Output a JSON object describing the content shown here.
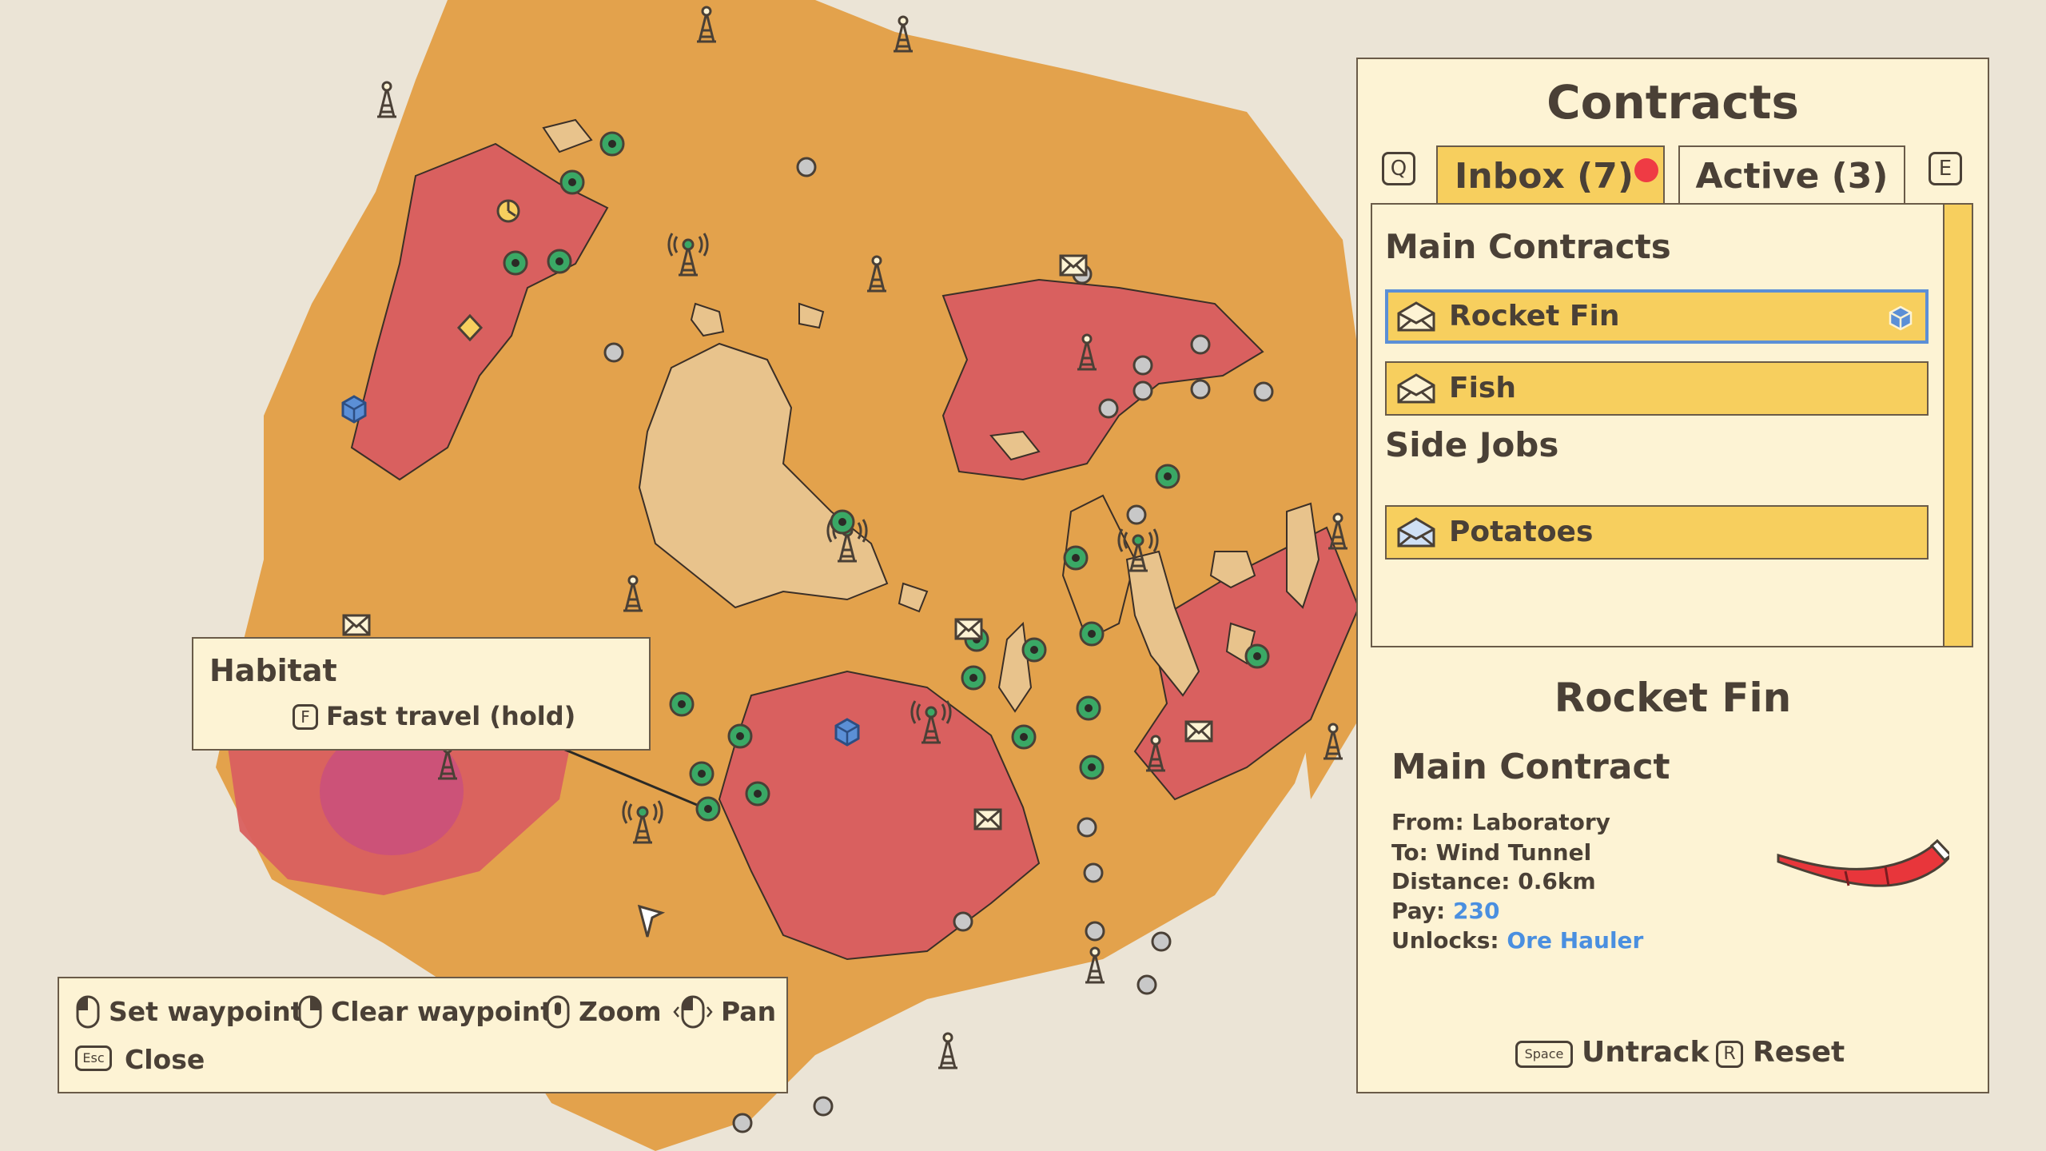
{
  "contracts": {
    "title": "Contracts",
    "prev_key": "Q",
    "next_key": "E",
    "tabs": [
      {
        "label": "Inbox (7)",
        "active": true,
        "has_notification": true
      },
      {
        "label": "Active (3)",
        "active": false
      }
    ],
    "sections": [
      {
        "heading": "Main Contracts",
        "items": [
          {
            "label": "Rocket Fin",
            "selected": true,
            "icon": "envelope-open-icon",
            "tracked_icon": "package-icon"
          },
          {
            "label": "Fish",
            "selected": false,
            "icon": "envelope-open-icon"
          }
        ]
      },
      {
        "heading": "Side Jobs",
        "items": [
          {
            "label": "Potatoes",
            "selected": false,
            "icon": "envelope-open-icon"
          }
        ]
      }
    ]
  },
  "detail": {
    "title": "Rocket Fin",
    "category": "Main Contract",
    "from_label": "From:",
    "from": "Laboratory",
    "to_label": "To:",
    "to": "Wind Tunnel",
    "distance_label": "Distance:",
    "distance": "0.6km",
    "pay_label": "Pay:",
    "pay": "230",
    "unlocks_label": "Unlocks:",
    "unlocks": "Ore Hauler",
    "untrack_key": "Space",
    "untrack_label": "Untrack",
    "reset_key": "R",
    "reset_label": "Reset"
  },
  "tooltip": {
    "title": "Habitat",
    "key": "F",
    "action": "Fast travel (hold)"
  },
  "controls": [
    {
      "icon": "mouse-left-icon",
      "label": "Set waypoint"
    },
    {
      "icon": "mouse-right-icon",
      "label": "Clear waypoint"
    },
    {
      "icon": "mouse-scroll-icon",
      "label": "Zoom"
    },
    {
      "icon": "mouse-drag-icon",
      "label": "Pan"
    },
    {
      "icon": "esc-key-icon",
      "key": "Esc",
      "label": "Close"
    }
  ],
  "colors": {
    "panel_bg": "#fdf3d4",
    "accent_yellow": "#f7cf5e",
    "selection_blue": "#5b8fd6",
    "link_blue": "#4a8fe0",
    "notification_red": "#ef3b44",
    "terrain_orange": "#e3a24c",
    "terrain_red": "#d9605f",
    "terrain_sand": "#e8c38c",
    "waypoint_green": "#3aa865"
  }
}
